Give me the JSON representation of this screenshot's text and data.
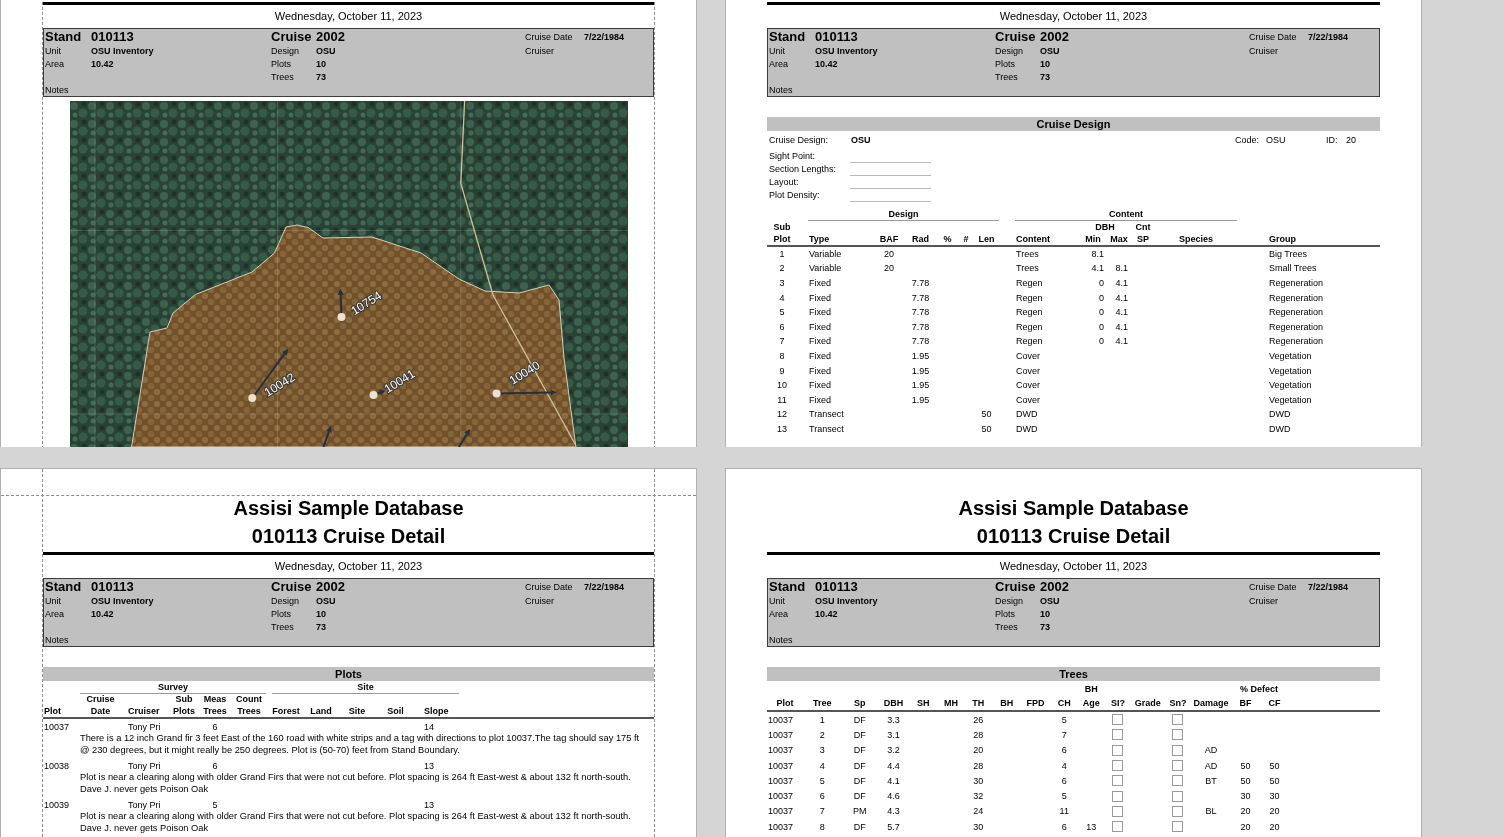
{
  "pages": [
    {
      "kind": "map",
      "margin_guides": true,
      "date": "Wednesday, October 11, 2023",
      "header": {
        "stand": {
          "label": "Stand",
          "value": "010113"
        },
        "stand_fields": [
          {
            "label": "Unit",
            "value": "OSU Inventory"
          },
          {
            "label": "Area",
            "value": "10.42"
          }
        ],
        "cruise": {
          "label": "Cruise",
          "value": "2002"
        },
        "cruise_fields": [
          {
            "label": "Design",
            "value": "OSU"
          },
          {
            "label": "Plots",
            "value": "10"
          },
          {
            "label": "Trees",
            "value": "73"
          }
        ],
        "cruise_info": [
          {
            "label": "Cruise Date",
            "value": "7/22/1984"
          },
          {
            "label": "Cruiser"
          }
        ],
        "notes_label": "Notes"
      },
      "map": {
        "plots": [
          {
            "label": "10754"
          },
          {
            "label": "10042"
          },
          {
            "label": "10041"
          },
          {
            "label": "10040"
          }
        ]
      }
    },
    {
      "kind": "cruise_design",
      "margin_guides": false,
      "date": "Wednesday, October 11, 2023",
      "header": {
        "stand": {
          "label": "Stand",
          "value": "010113"
        },
        "stand_fields": [
          {
            "label": "Unit",
            "value": "OSU Inventory"
          },
          {
            "label": "Area",
            "value": "10.42"
          }
        ],
        "cruise": {
          "label": "Cruise",
          "value": "2002"
        },
        "cruise_fields": [
          {
            "label": "Design",
            "value": "OSU"
          },
          {
            "label": "Plots",
            "value": "10"
          },
          {
            "label": "Trees",
            "value": "73"
          }
        ],
        "cruise_info": [
          {
            "label": "Cruise Date",
            "value": "7/22/1984"
          },
          {
            "label": "Cruiser"
          }
        ],
        "notes_label": "Notes"
      },
      "section": {
        "title": "Cruise Design",
        "design": {
          "label": "Cruise Design:",
          "value": "OSU"
        },
        "code": {
          "label": "Code:",
          "value": "OSU"
        },
        "id": {
          "label": "ID:",
          "value": "20"
        },
        "blank_fields": [
          {
            "label": "Sight Point:"
          },
          {
            "label": "Section Lengths:"
          },
          {
            "label": "Layout:"
          },
          {
            "label": "Plot Density:"
          }
        ],
        "column_groups": [
          "Design",
          "Content"
        ],
        "dbh_heading": "DBH",
        "columns": [
          "Sub Plot",
          "Type",
          "BAF",
          "Rad",
          "%",
          "#",
          "Len",
          "Content",
          "Min",
          "Max",
          "Cnt SP",
          "Species",
          "Group"
        ],
        "rows": [
          {
            "sub_plot": "1",
            "type": "Variable",
            "baf": "20",
            "content": "Trees",
            "min": "8.1",
            "group": "Big Trees"
          },
          {
            "sub_plot": "2",
            "type": "Variable",
            "baf": "20",
            "content": "Trees",
            "min": "4.1",
            "max": "8.1",
            "group": "Small Trees"
          },
          {
            "sub_plot": "3",
            "type": "Fixed",
            "rad": "7.78",
            "content": "Regen",
            "min": "0",
            "max": "4.1",
            "group": "Regeneration"
          },
          {
            "sub_plot": "4",
            "type": "Fixed",
            "rad": "7.78",
            "content": "Regen",
            "min": "0",
            "max": "4.1",
            "group": "Regeneration"
          },
          {
            "sub_plot": "5",
            "type": "Fixed",
            "rad": "7.78",
            "content": "Regen",
            "min": "0",
            "max": "4.1",
            "group": "Regeneration"
          },
          {
            "sub_plot": "6",
            "type": "Fixed",
            "rad": "7.78",
            "content": "Regen",
            "min": "0",
            "max": "4.1",
            "group": "Regeneration"
          },
          {
            "sub_plot": "7",
            "type": "Fixed",
            "rad": "7.78",
            "content": "Regen",
            "min": "0",
            "max": "4.1",
            "group": "Regeneration"
          },
          {
            "sub_plot": "8",
            "type": "Fixed",
            "rad": "1.95",
            "content": "Cover",
            "group": "Vegetation"
          },
          {
            "sub_plot": "9",
            "type": "Fixed",
            "rad": "1.95",
            "content": "Cover",
            "group": "Vegetation"
          },
          {
            "sub_plot": "10",
            "type": "Fixed",
            "rad": "1.95",
            "content": "Cover",
            "group": "Vegetation"
          },
          {
            "sub_plot": "11",
            "type": "Fixed",
            "rad": "1.95",
            "content": "Cover",
            "group": "Vegetation"
          },
          {
            "sub_plot": "12",
            "type": "Transect",
            "len": "50",
            "content": "DWD",
            "group": "DWD"
          },
          {
            "sub_plot": "13",
            "type": "Transect",
            "len": "50",
            "content": "DWD",
            "group": "DWD"
          }
        ]
      }
    },
    {
      "kind": "plots",
      "margin_guides": true,
      "title": [
        "Assisi Sample Database",
        "010113 Cruise Detail"
      ],
      "date": "Wednesday, October 11, 2023",
      "header": {
        "stand": {
          "label": "Stand",
          "value": "010113"
        },
        "stand_fields": [
          {
            "label": "Unit",
            "value": "OSU Inventory"
          },
          {
            "label": "Area",
            "value": "10.42"
          }
        ],
        "cruise": {
          "label": "Cruise",
          "value": "2002"
        },
        "cruise_fields": [
          {
            "label": "Design",
            "value": "OSU"
          },
          {
            "label": "Plots",
            "value": "10"
          },
          {
            "label": "Trees",
            "value": "73"
          }
        ],
        "cruise_info": [
          {
            "label": "Cruise Date",
            "value": "7/22/1984"
          },
          {
            "label": "Cruiser"
          }
        ],
        "notes_label": "Notes"
      },
      "section": {
        "title": "Plots",
        "column_groups": [
          "Survey",
          "Site"
        ],
        "columns": [
          "Plot",
          "Cruise Date",
          "Cruiser",
          "Sub Plots",
          "Meas Trees",
          "Count Trees",
          "Forest",
          "Land",
          "Site",
          "Soil",
          "Slope"
        ],
        "rows": [
          {
            "plot": "10037",
            "cruiser": "Tony Pri",
            "meas_trees": "6",
            "slope": "14",
            "notes": "There is a 12 inch Grand fir 3 feet East of the 160 road with white strips and a tag with directions to plot 10037.The tag should say 175 ft @ 230 degrees, but it might really be 250 degrees. Plot is (50-70) feet from Stand Boundary."
          },
          {
            "plot": "10038",
            "cruiser": "Tony Pri",
            "meas_trees": "6",
            "slope": "13",
            "notes": "Plot is near a clearing along with older Grand Firs that were not cut before. Plot spacing is 264 ft East-west & about 132 ft north-south. Dave J. never gets Poison Oak"
          },
          {
            "plot": "10039",
            "cruiser": "Tony Pri",
            "meas_trees": "5",
            "slope": "13",
            "notes": "Plot is near a clearing along with older Grand Firs that were not cut before. Plot spacing is 264 ft East-west & about 132 ft north-south. Dave J. never gets Poison Oak"
          }
        ]
      }
    },
    {
      "kind": "trees",
      "margin_guides": false,
      "title": [
        "Assisi Sample Database",
        "010113 Cruise Detail"
      ],
      "date": "Wednesday, October 11, 2023",
      "header": {
        "stand": {
          "label": "Stand",
          "value": "010113"
        },
        "stand_fields": [
          {
            "label": "Unit",
            "value": "OSU Inventory"
          },
          {
            "label": "Area",
            "value": "10.42"
          }
        ],
        "cruise": {
          "label": "Cruise",
          "value": "2002"
        },
        "cruise_fields": [
          {
            "label": "Design",
            "value": "OSU"
          },
          {
            "label": "Plots",
            "value": "10"
          },
          {
            "label": "Trees",
            "value": "73"
          }
        ],
        "cruise_info": [
          {
            "label": "Cruise Date",
            "value": "7/22/1984"
          },
          {
            "label": "Cruiser"
          }
        ],
        "notes_label": "Notes"
      },
      "section": {
        "title": "Trees",
        "defect_heading": "% Defect",
        "columns": [
          "Plot",
          "Tree",
          "Sp",
          "DBH",
          "SH",
          "MH",
          "TH",
          "BH",
          "FPD",
          "CH",
          "BH Age",
          "SI?",
          "Grade",
          "Sn?",
          "Damage",
          "BF",
          "CF"
        ],
        "rows": [
          {
            "plot": "10037",
            "tree": "1",
            "sp": "DF",
            "dbh": "3.3",
            "th": "26",
            "ch": "5",
            "si_checked": false,
            "sn_checked": false
          },
          {
            "plot": "10037",
            "tree": "2",
            "sp": "DF",
            "dbh": "3.1",
            "th": "28",
            "ch": "7",
            "si_checked": false,
            "sn_checked": false
          },
          {
            "plot": "10037",
            "tree": "3",
            "sp": "DF",
            "dbh": "3.2",
            "th": "20",
            "ch": "6",
            "si_checked": false,
            "sn_checked": false,
            "damage": "AD"
          },
          {
            "plot": "10037",
            "tree": "4",
            "sp": "DF",
            "dbh": "4.4",
            "th": "28",
            "ch": "4",
            "si_checked": false,
            "sn_checked": false,
            "damage": "AD",
            "defect_bf": "50",
            "defect_cf": "50"
          },
          {
            "plot": "10037",
            "tree": "5",
            "sp": "DF",
            "dbh": "4.1",
            "th": "30",
            "ch": "6",
            "si_checked": false,
            "sn_checked": false,
            "damage": "BT",
            "defect_bf": "50",
            "defect_cf": "50"
          },
          {
            "plot": "10037",
            "tree": "6",
            "sp": "DF",
            "dbh": "4.6",
            "th": "32",
            "ch": "5",
            "si_checked": false,
            "sn_checked": false,
            "defect_bf": "30",
            "defect_cf": "30"
          },
          {
            "plot": "10037",
            "tree": "7",
            "sp": "PM",
            "dbh": "4.3",
            "th": "24",
            "ch": "11",
            "si_checked": false,
            "sn_checked": false,
            "damage": "BL",
            "defect_bf": "20",
            "defect_cf": "20"
          },
          {
            "plot": "10037",
            "tree": "8",
            "sp": "DF",
            "dbh": "5.7",
            "th": "30",
            "ch": "6",
            "bh_age": "13",
            "si_checked": false,
            "sn_checked": false,
            "defect_bf": "20",
            "defect_cf": "20"
          }
        ]
      }
    }
  ]
}
